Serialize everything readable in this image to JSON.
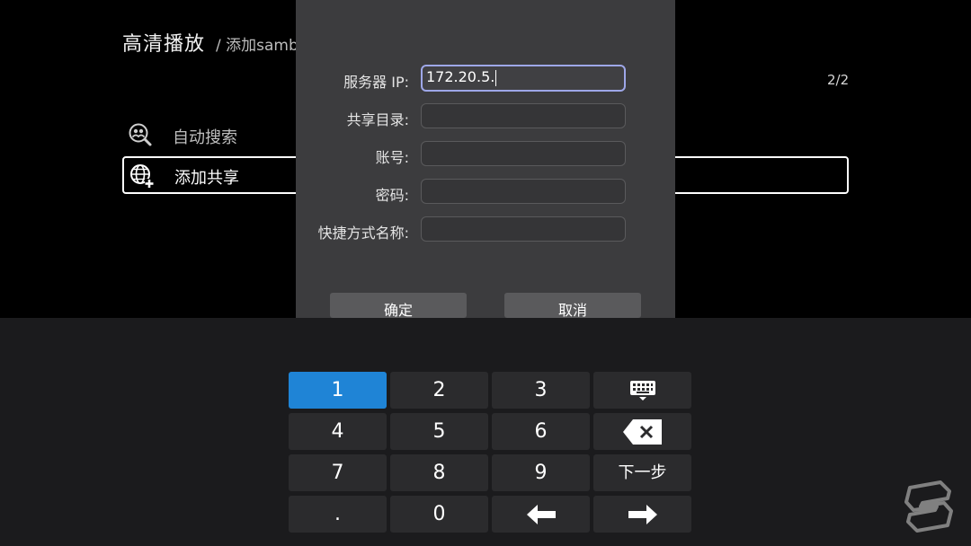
{
  "header": {
    "title": "高清播放",
    "subtitle": "/ 添加samb"
  },
  "page_count": "2/2",
  "menu": {
    "items": [
      {
        "label": "自动搜索",
        "icon": "people-search-icon"
      },
      {
        "label": "添加共享",
        "icon": "globe-plus-icon"
      }
    ]
  },
  "dialog": {
    "fields": [
      {
        "label": "服务器 IP:",
        "value": "172.20.5.",
        "placeholder": ""
      },
      {
        "label": "共享目录:",
        "value": "",
        "placeholder": ""
      },
      {
        "label": "账号:",
        "value": "",
        "placeholder": ""
      },
      {
        "label": "密码:",
        "value": "",
        "placeholder": ""
      },
      {
        "label": "快捷方式名称:",
        "value": "",
        "placeholder": ""
      }
    ],
    "ok_label": "确定",
    "cancel_label": "取消"
  },
  "keyboard": {
    "keys": {
      "k1": "1",
      "k2": "2",
      "k3": "3",
      "k4": "4",
      "k5": "5",
      "k6": "6",
      "k7": "7",
      "k8": "8",
      "k9": "9",
      "next": "下一步",
      "dot": ".",
      "k0": "0"
    },
    "icons": {
      "hide": "keyboard-hide-icon",
      "backspace": "backspace-icon",
      "left": "arrow-left-icon",
      "right": "arrow-right-icon"
    },
    "active_color": "#1f84d6"
  },
  "watermark": "logo-icon"
}
